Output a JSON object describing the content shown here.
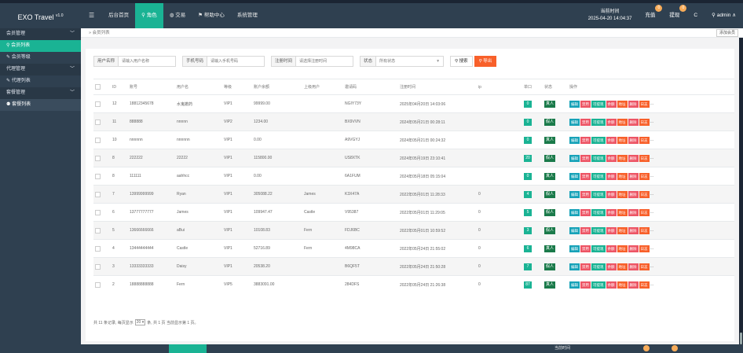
{
  "app": {
    "brand": "EXO Travel",
    "version": "v1.0"
  },
  "nav": {
    "menu_icon": "menu-icon",
    "items": [
      {
        "label": "后台首页",
        "icon": ""
      },
      {
        "label": "角色",
        "icon": "user-icon"
      },
      {
        "label": "交易",
        "icon": "globe-icon"
      },
      {
        "label": "帮助中心",
        "icon": "flag-icon"
      },
      {
        "label": "系统管理",
        "icon": ""
      }
    ]
  },
  "topright": {
    "time_label": "当前时间",
    "time_value": "2025-04-20 14:04:37",
    "recharge_label": "充值",
    "recharge_badge": "0",
    "withdraw_label": "提现",
    "withdraw_badge": "0",
    "refresh_icon": "refresh-icon",
    "user_label": "admin",
    "user_icon": "user-icon"
  },
  "sidebar": {
    "items": [
      {
        "label": "会员管理",
        "type": "group",
        "chevron": "﹀"
      },
      {
        "label": "会员列表",
        "type": "active",
        "icon": "user-icon"
      },
      {
        "label": "会员等级",
        "type": "item",
        "icon": "wrench-icon"
      },
      {
        "label": "代理管理",
        "type": "group",
        "chevron": "﹀"
      },
      {
        "label": "代理列表",
        "type": "item",
        "icon": "wrench-icon"
      },
      {
        "label": "套餐管理",
        "type": "group",
        "chevron": "﹀"
      },
      {
        "label": "套餐列表",
        "type": "hl",
        "icon": "users-icon"
      }
    ]
  },
  "tabs": {
    "breadcrumb": "会员列表",
    "add_button": "添加会员"
  },
  "filters": {
    "username_label": "用户名称",
    "username_placeholder": "请输入用户名称",
    "phone_label": "手机号码",
    "phone_placeholder": "请输入手机号码",
    "regtime_label": "注册时间",
    "regtime_placeholder": "请选择注册时间",
    "status_label": "状态",
    "status_placeholder": "所有状态",
    "search_label": "搜索",
    "export_label": "导出"
  },
  "table": {
    "headers": [
      "ID",
      "账号",
      "用户名",
      "等级",
      "账户余额",
      "上级用户",
      "邀请码",
      "注册时间",
      "ip",
      "单口",
      "状态",
      "操作"
    ],
    "actions": [
      "编辑",
      "禁用",
      "可提现",
      "余额",
      "地址",
      "删除",
      "日志"
    ],
    "more": "···",
    "rows": [
      {
        "id": "12",
        "account": "18812345678",
        "username": "水鬼撤药",
        "level": "VIP1",
        "balance": "99999.00",
        "parent": "",
        "code": "NGIY73Y",
        "regtime": "2025年04月20日 14:03:06",
        "ip": "",
        "count": "0",
        "status": "真人"
      },
      {
        "id": "11",
        "account": "888888",
        "username": "nnnnn",
        "level": "VIP2",
        "balance": "1234.00",
        "parent": "",
        "code": "BX9VVN",
        "regtime": "2024年05月21日 00:28:11",
        "ip": "",
        "count": "0",
        "status": "假人"
      },
      {
        "id": "10",
        "account": "nnnnnn",
        "username": "nnnnnn",
        "level": "VIP1",
        "balance": "0.00",
        "parent": "",
        "code": "A9VGYJ",
        "regtime": "2024年05月21日 00:24:32",
        "ip": "",
        "count": "0",
        "status": "真人"
      },
      {
        "id": "8",
        "account": "222222",
        "username": "22222",
        "level": "VIP1",
        "balance": "115800.00",
        "parent": "",
        "code": "US8XTK",
        "regtime": "2024年05月19日 23:10:41",
        "ip": "",
        "count": "20",
        "status": "假人"
      },
      {
        "id": "8",
        "account": "111111",
        "username": "aahhcc",
        "level": "VIP1",
        "balance": "0.00",
        "parent": "",
        "code": "6A1FUM",
        "regtime": "2024年05月18日 05:15:04",
        "ip": "",
        "count": "0",
        "status": "真人"
      },
      {
        "id": "7",
        "account": "13999999999",
        "username": "Ryan",
        "level": "VIP1",
        "balance": "305088.22",
        "parent": "James",
        "code": "K3X47A",
        "regtime": "2022年05月01日 11:28:33",
        "ip": "0",
        "count": "4",
        "status": "假人"
      },
      {
        "id": "6",
        "account": "13777777777",
        "username": "James",
        "level": "VIP1",
        "balance": "109947.47",
        "parent": "Castle",
        "code": "V95387",
        "regtime": "2022年05月01日 11:29:05",
        "ip": "0",
        "count": "5",
        "status": "假人"
      },
      {
        "id": "5",
        "account": "13666666666",
        "username": "aBui",
        "level": "VIP1",
        "balance": "10108.83",
        "parent": "Fern",
        "code": "FDJ6BC",
        "regtime": "2022年05月01日 10:59:52",
        "ip": "0",
        "count": "3",
        "status": "假人"
      },
      {
        "id": "4",
        "account": "13444444444",
        "username": "Castle",
        "level": "VIP1",
        "balance": "52716.89",
        "parent": "Fern",
        "code": "4M98CA",
        "regtime": "2022年05月24日 21:55:02",
        "ip": "0",
        "count": "6",
        "status": "真人"
      },
      {
        "id": "3",
        "account": "13333333333",
        "username": "Daisy",
        "level": "VIP1",
        "balance": "20538.20",
        "parent": "",
        "code": "B6QF5T",
        "regtime": "2022年05月24日 21:50:28",
        "ip": "0",
        "count": "7",
        "status": "假人"
      },
      {
        "id": "2",
        "account": "18888888888",
        "username": "Fern",
        "level": "VIP5",
        "balance": "3883091.00",
        "parent": "",
        "code": "284DFS",
        "regtime": "2022年05月24日 21:26:38",
        "ip": "0",
        "count": "87",
        "status": "真人"
      }
    ]
  },
  "footer": {
    "text1": "共 11 条记录, 每页显示",
    "page_size": "20",
    "text2": "条, 共 1 页 当前显示第 1 页。"
  },
  "bottom": {
    "time_label": "当前时间"
  }
}
